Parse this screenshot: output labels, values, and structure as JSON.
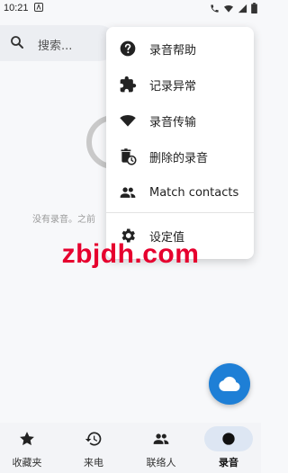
{
  "status_bar": {
    "time": "10:21"
  },
  "search": {
    "placeholder": "搜索..."
  },
  "empty_state": {
    "text": "没有录音。之前"
  },
  "menu": {
    "items": [
      {
        "label": "录音帮助",
        "icon": "help-icon"
      },
      {
        "label": "记录异常",
        "icon": "puzzle-icon"
      },
      {
        "label": "录音传输",
        "icon": "wifi-icon"
      },
      {
        "label": "删除的录音",
        "icon": "deleted-recordings-icon"
      },
      {
        "label": "Match contacts",
        "icon": "contacts-icon"
      },
      {
        "label": "设定值",
        "icon": "settings-icon"
      }
    ]
  },
  "watermark": "zbjdh.com",
  "fab": {
    "icon": "cloud-icon"
  },
  "bottom_nav": {
    "items": [
      {
        "label": "收藏夹",
        "icon": "star-icon"
      },
      {
        "label": "来电",
        "icon": "history-icon"
      },
      {
        "label": "联络人",
        "icon": "people-icon"
      },
      {
        "label": "录音",
        "icon": "record-icon",
        "active": true
      }
    ]
  },
  "colors": {
    "accent": "#1e7fd6",
    "watermark": "#e6002e",
    "active_pill": "#dde6f3"
  }
}
